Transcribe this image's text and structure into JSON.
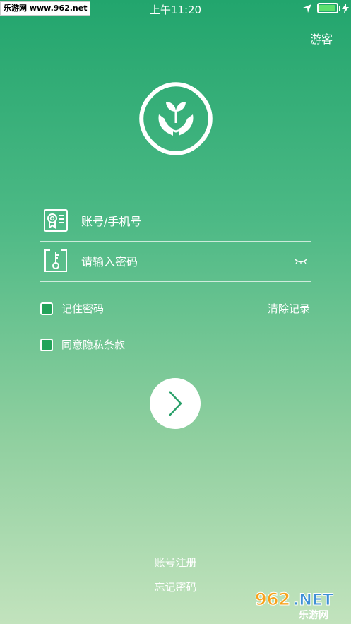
{
  "status_bar": {
    "watermark": "乐游网 www.962.net",
    "time": "上午11:20",
    "battery_color": "#5de06e"
  },
  "header": {
    "guest_label": "游客"
  },
  "login_form": {
    "account_placeholder": "账号/手机号",
    "password_placeholder": "请输入密码",
    "remember_label": "记住密码",
    "clear_label": "清除记录",
    "agree_label": "同意隐私条款"
  },
  "footer": {
    "register_label": "账号注册",
    "forgot_label": "忘记密码"
  },
  "bottom_watermark": {
    "big": "962.NET",
    "small": "乐游网"
  },
  "colors": {
    "gradient_top": "#22a56d",
    "gradient_bottom": "#c2e3bd",
    "checkbox": "#23a35a",
    "arrow": "#2aa06a"
  }
}
